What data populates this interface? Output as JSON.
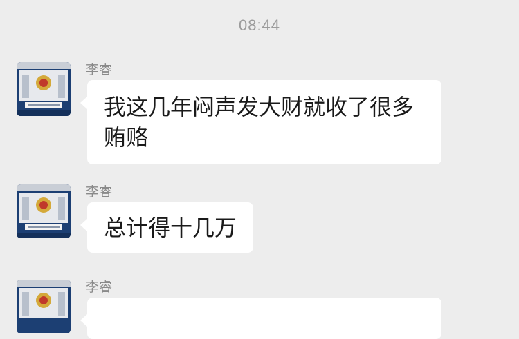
{
  "chat": {
    "timestamp": "08:44",
    "messages": [
      {
        "sender": "李睿",
        "text": "我这几年闷声发大财就收了很多贿赂"
      },
      {
        "sender": "李睿",
        "text": "总计得十几万"
      },
      {
        "sender": "李睿",
        "text": ""
      }
    ]
  },
  "colors": {
    "background": "#EDEDED",
    "bubble": "#FFFFFF",
    "avatar_primary": "#1C3F73",
    "emblem": "#D4A93A"
  },
  "icons": {
    "avatar": "building-with-emblem"
  }
}
